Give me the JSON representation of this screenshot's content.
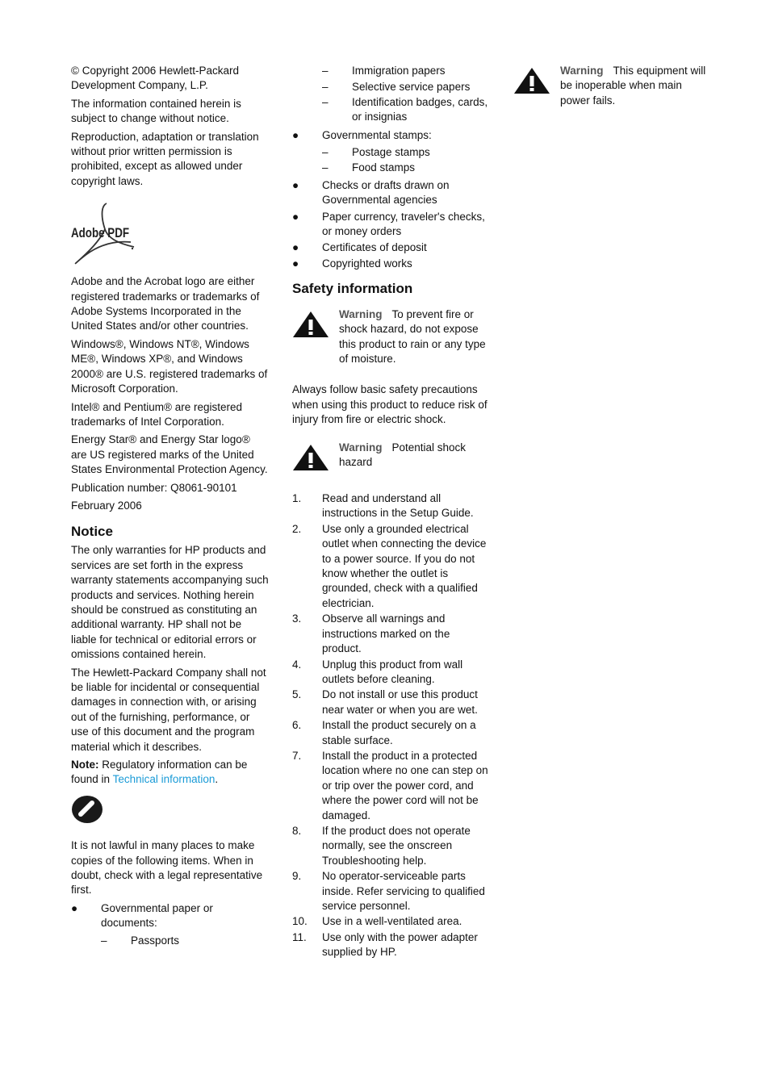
{
  "column1": {
    "copyright": "© Copyright 2006 Hewlett-Packard Development Company, L.P.",
    "info_change": "The information contained herein is subject to change without notice.",
    "reproduction": "Reproduction, adaptation or translation without prior written permission is prohibited, except as allowed under copyright laws.",
    "logo_text": "Adobe PDF",
    "adobe_trademark": "Adobe and the Acrobat logo are either registered trademarks or trademarks of Adobe Systems Incorporated in the United States and/or other countries.",
    "windows_trademark": "Windows®, Windows NT®, Windows ME®, Windows XP®, and Windows 2000® are U.S. registered trademarks of Microsoft Corporation.",
    "intel_trademark": "Intel® and Pentium® are registered trademarks of Intel Corporation.",
    "energy_star": "Energy Star® and Energy Star logo® are US registered marks of the United States Environmental Protection Agency.",
    "publication_number": "Publication number: Q8061-90101",
    "date": "February 2006",
    "notice_heading": "Notice",
    "notice_p1": "The only warranties for HP products and services are set forth in the express warranty statements accompanying such products and services. Nothing herein should be construed as constituting an additional warranty. HP shall not be liable for technical or editorial errors or omissions contained herein.",
    "notice_p2": "The Hewlett-Packard Company shall not be liable for incidental or consequential damages in connection with, or arising out of the furnishing, performance, or use of this document and the program material which it describes.",
    "note_label": "Note:",
    "note_text": " Regulatory information can be found in ",
    "note_link": "Technical information",
    "note_end": ".",
    "not_lawful": "It is not lawful in many places to make copies of the following items. When in doubt, check with a legal representative first."
  },
  "copy_list": {
    "bullet": "●",
    "dash": "–",
    "items": [
      {
        "label": "Governmental paper or documents:",
        "sub": [
          "Passports",
          "Immigration papers",
          "Selective service papers",
          "Identification badges, cards, or insignias"
        ]
      },
      {
        "label": "Governmental stamps:",
        "sub": [
          "Postage stamps",
          "Food stamps"
        ]
      },
      {
        "label": "Checks or drafts drawn on Governmental agencies"
      },
      {
        "label": "Paper currency, traveler's checks, or money orders"
      },
      {
        "label": "Certificates of deposit"
      },
      {
        "label": "Copyrighted works"
      }
    ]
  },
  "safety": {
    "heading": "Safety information",
    "warning1_label": "Warning",
    "warning1_text": "To prevent fire or shock hazard, do not expose this product to rain or any type of moisture.",
    "precautions": "Always follow basic safety precautions when using this product to reduce risk of injury from fire or electric shock.",
    "warning2_label": "Warning",
    "warning2_text": "Potential shock hazard",
    "steps": [
      {
        "num": "1.",
        "text": "Read and understand all instructions in the Setup Guide."
      },
      {
        "num": "2.",
        "text": "Use only a grounded electrical outlet when connecting the device to a power source. If you do not know whether the outlet is grounded, check with a qualified electrician."
      },
      {
        "num": "3.",
        "text": "Observe all warnings and instructions marked on the product."
      },
      {
        "num": "4.",
        "text": "Unplug this product from wall outlets before cleaning."
      },
      {
        "num": "5.",
        "text": "Do not install or use this product near water or when you are wet."
      },
      {
        "num": "6.",
        "text": "Install the product securely on a stable surface."
      },
      {
        "num": "7.",
        "text": "Install the product in a protected location where no one can step on or trip over the power cord, and where the power cord will not be damaged."
      },
      {
        "num": "8.",
        "text": "If the product does not operate normally, see the onscreen Troubleshooting help."
      },
      {
        "num": "9.",
        "text": "No operator-serviceable parts inside. Refer servicing to qualified service personnel."
      },
      {
        "num": "10.",
        "text": "Use in a well-ventilated area."
      },
      {
        "num": "11.",
        "text": "Use only with the power adapter supplied by HP."
      }
    ],
    "warning3_label": "Warning",
    "warning3_text": "This equipment will be inoperable when main power fails."
  },
  "colors": {
    "link": "#1a9bd7",
    "warning_label": "#555555",
    "text": "#111111"
  }
}
